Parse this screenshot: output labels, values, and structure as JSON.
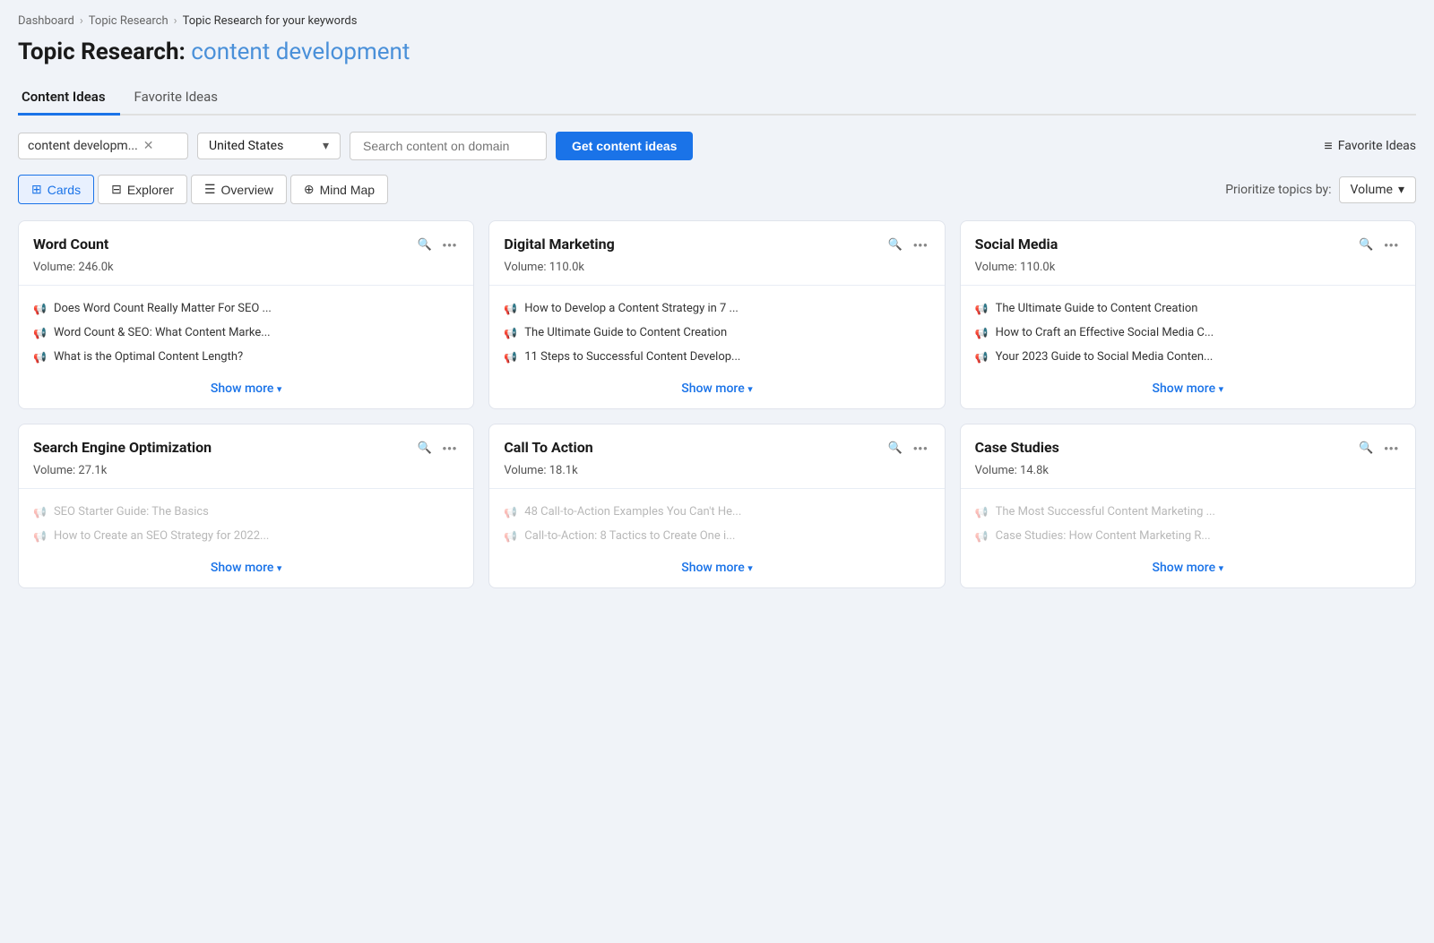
{
  "breadcrumb": {
    "items": [
      "Dashboard",
      "Topic Research",
      "Topic Research for your keywords"
    ]
  },
  "page": {
    "title_prefix": "Topic Research:",
    "title_keyword": "content development"
  },
  "tabs": [
    {
      "id": "content-ideas",
      "label": "Content Ideas",
      "active": true
    },
    {
      "id": "favorite-ideas",
      "label": "Favorite Ideas",
      "active": false
    }
  ],
  "toolbar": {
    "keyword_value": "content developm...",
    "country_value": "United States",
    "domain_placeholder": "Search content on domain",
    "get_ideas_label": "Get content ideas",
    "favorite_ideas_label": "Favorite Ideas"
  },
  "view": {
    "options": [
      {
        "id": "cards",
        "label": "Cards",
        "active": true
      },
      {
        "id": "explorer",
        "label": "Explorer",
        "active": false
      },
      {
        "id": "overview",
        "label": "Overview",
        "active": false
      },
      {
        "id": "mindmap",
        "label": "Mind Map",
        "active": false
      }
    ],
    "prioritize_label": "Prioritize topics by:",
    "prioritize_value": "Volume"
  },
  "cards": [
    {
      "id": "word-count",
      "title": "Word Count",
      "volume": "Volume: 246.0k",
      "items": [
        {
          "text": "Does Word Count Really Matter For SEO ...",
          "icon": "green"
        },
        {
          "text": "Word Count & SEO: What Content Marke...",
          "icon": "blue"
        },
        {
          "text": "What is the Optimal Content Length?",
          "icon": "blue"
        }
      ],
      "show_more": "Show more"
    },
    {
      "id": "digital-marketing",
      "title": "Digital Marketing",
      "volume": "Volume: 110.0k",
      "items": [
        {
          "text": "How to Develop a Content Strategy in 7 ...",
          "icon": "green"
        },
        {
          "text": "The Ultimate Guide to Content Creation",
          "icon": "blue"
        },
        {
          "text": "11 Steps to Successful Content Develop...",
          "icon": "blue"
        }
      ],
      "show_more": "Show more"
    },
    {
      "id": "social-media",
      "title": "Social Media",
      "volume": "Volume: 110.0k",
      "items": [
        {
          "text": "The Ultimate Guide to Content Creation",
          "icon": "green"
        },
        {
          "text": "How to Craft an Effective Social Media C...",
          "icon": "blue"
        },
        {
          "text": "Your 2023 Guide to Social Media Conten...",
          "icon": "blue"
        }
      ],
      "show_more": "Show more"
    },
    {
      "id": "seo",
      "title": "Search Engine Optimization",
      "volume": "Volume: 27.1k",
      "items": [
        {
          "text": "SEO Starter Guide: The Basics",
          "icon": "green"
        },
        {
          "text": "How to Create an SEO Strategy for 2022...",
          "icon": "blue"
        }
      ],
      "show_more": "Show more",
      "faded": true
    },
    {
      "id": "call-to-action",
      "title": "Call To Action",
      "volume": "Volume: 18.1k",
      "items": [
        {
          "text": "48 Call-to-Action Examples You Can't He...",
          "icon": "green"
        },
        {
          "text": "Call-to-Action: 8 Tactics to Create One i...",
          "icon": "blue"
        }
      ],
      "show_more": "Show more",
      "faded": true
    },
    {
      "id": "case-studies",
      "title": "Case Studies",
      "volume": "Volume: 14.8k",
      "items": [
        {
          "text": "The Most Successful Content Marketing ...",
          "icon": "green"
        },
        {
          "text": "Case Studies: How Content Marketing R...",
          "icon": "blue"
        }
      ],
      "show_more": "Show more",
      "faded": true
    }
  ]
}
